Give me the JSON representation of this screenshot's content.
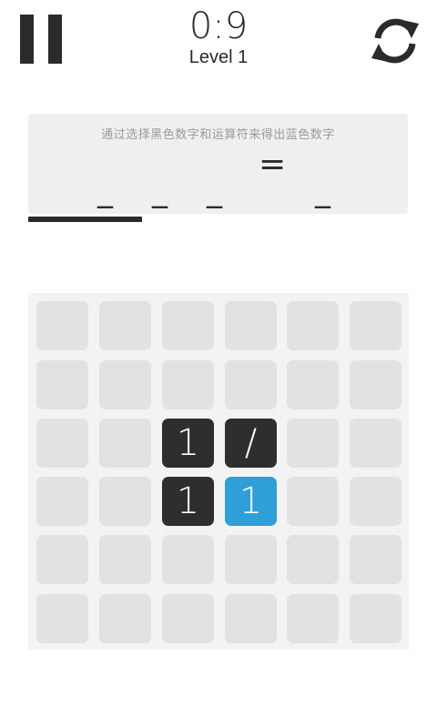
{
  "header": {
    "timer": "0:9",
    "level": "Level 1",
    "pause_icon": "pause-icon",
    "restart_icon": "refresh-icon"
  },
  "hint": {
    "instruction": "通过选择黑色数字和运算符来得出蓝色数字",
    "slots": [
      "_",
      "_",
      "_"
    ],
    "equals": "=",
    "result_slot": "_"
  },
  "progress": {
    "fraction": 0.3
  },
  "colors": {
    "dark_tile": "#2e2e2e",
    "blue_tile": "#2e9fd8",
    "empty_tile": "#e2e2e2",
    "board_bg": "#f3f3f3",
    "panel_bg": "#efefef"
  },
  "board": {
    "rows": 6,
    "cols": 6,
    "cells": [
      [
        "",
        "",
        "",
        "",
        "",
        ""
      ],
      [
        "",
        "",
        "",
        "",
        "",
        ""
      ],
      [
        "",
        "",
        "1",
        "/",
        "",
        ""
      ],
      [
        "",
        "",
        "1",
        "1",
        "",
        ""
      ],
      [
        "",
        "",
        "",
        "",
        "",
        ""
      ],
      [
        "",
        "",
        "",
        "",
        "",
        ""
      ]
    ],
    "types": [
      [
        "empty",
        "empty",
        "empty",
        "empty",
        "empty",
        "empty"
      ],
      [
        "empty",
        "empty",
        "empty",
        "empty",
        "empty",
        "empty"
      ],
      [
        "empty",
        "empty",
        "dark",
        "dark",
        "empty",
        "empty"
      ],
      [
        "empty",
        "empty",
        "dark",
        "blue",
        "empty",
        "empty"
      ],
      [
        "empty",
        "empty",
        "empty",
        "empty",
        "empty",
        "empty"
      ],
      [
        "empty",
        "empty",
        "empty",
        "empty",
        "empty",
        "empty"
      ]
    ]
  }
}
